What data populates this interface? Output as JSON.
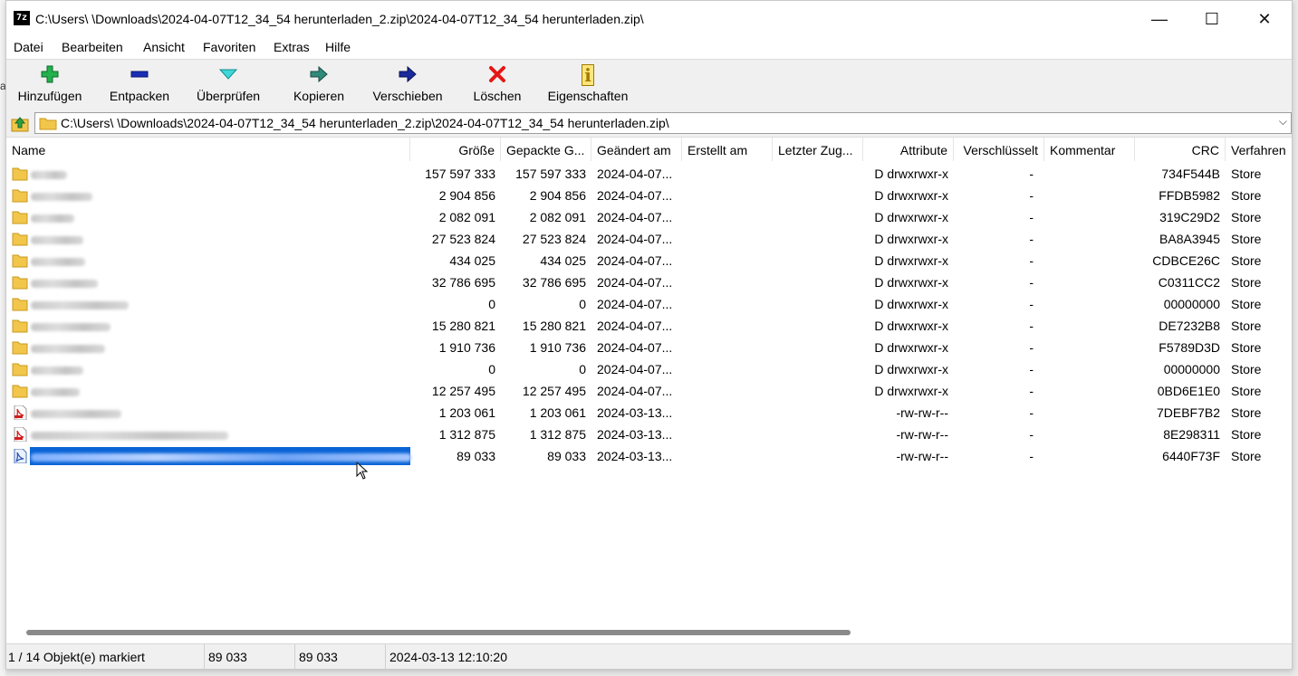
{
  "window": {
    "title": "C:\\Users\\        \\Downloads\\2024-04-07T12_34_54 herunterladen_2.zip\\2024-04-07T12_34_54 herunterladen.zip\\",
    "app_icon_text": "7z",
    "minimize": "—",
    "maximize": "☐",
    "close": "✕"
  },
  "menu": [
    "Datei",
    "Bearbeiten",
    "Ansicht",
    "Favoriten",
    "Extras",
    "Hilfe"
  ],
  "toolbar": {
    "add": "Hinzufügen",
    "extract": "Entpacken",
    "test": "Überprüfen",
    "copy": "Kopieren",
    "move": "Verschieben",
    "delete": "Löschen",
    "info": "Eigenschaften",
    "info_glyph": "i"
  },
  "address": {
    "path": "C:\\Users\\        \\Downloads\\2024-04-07T12_34_54 herunterladen_2.zip\\2024-04-07T12_34_54 herunterladen.zip\\",
    "chevron": "⌵"
  },
  "columns": {
    "name": "Name",
    "size": "Größe",
    "packed": "Gepackte G...",
    "modified": "Geändert am",
    "created": "Erstellt am",
    "accessed": "Letzter Zug...",
    "attributes": "Attribute",
    "encrypted": "Verschlüsselt",
    "comment": "Kommentar",
    "crc": "CRC",
    "method": "Verfahren"
  },
  "rows": [
    {
      "type": "folder",
      "size": "157 597 333",
      "packed": "157 597 333",
      "modified": "2024-04-07...",
      "attr": "D drwxrwxr-x",
      "enc": "-",
      "crc": "734F544B",
      "method": "Store"
    },
    {
      "type": "folder",
      "size": "2 904 856",
      "packed": "2 904 856",
      "modified": "2024-04-07...",
      "attr": "D drwxrwxr-x",
      "enc": "-",
      "crc": "FFDB5982",
      "method": "Store"
    },
    {
      "type": "folder",
      "size": "2 082 091",
      "packed": "2 082 091",
      "modified": "2024-04-07...",
      "attr": "D drwxrwxr-x",
      "enc": "-",
      "crc": "319C29D2",
      "method": "Store"
    },
    {
      "type": "folder",
      "size": "27 523 824",
      "packed": "27 523 824",
      "modified": "2024-04-07...",
      "attr": "D drwxrwxr-x",
      "enc": "-",
      "crc": "BA8A3945",
      "method": "Store"
    },
    {
      "type": "folder",
      "size": "434 025",
      "packed": "434 025",
      "modified": "2024-04-07...",
      "attr": "D drwxrwxr-x",
      "enc": "-",
      "crc": "CDBCE26C",
      "method": "Store"
    },
    {
      "type": "folder",
      "size": "32 786 695",
      "packed": "32 786 695",
      "modified": "2024-04-07...",
      "attr": "D drwxrwxr-x",
      "enc": "-",
      "crc": "C0311CC2",
      "method": "Store"
    },
    {
      "type": "folder",
      "size": "0",
      "packed": "0",
      "modified": "2024-04-07...",
      "attr": "D drwxrwxr-x",
      "enc": "-",
      "crc": "00000000",
      "method": "Store"
    },
    {
      "type": "folder",
      "size": "15 280 821",
      "packed": "15 280 821",
      "modified": "2024-04-07...",
      "attr": "D drwxrwxr-x",
      "enc": "-",
      "crc": "DE7232B8",
      "method": "Store"
    },
    {
      "type": "folder",
      "size": "1 910 736",
      "packed": "1 910 736",
      "modified": "2024-04-07...",
      "attr": "D drwxrwxr-x",
      "enc": "-",
      "crc": "F5789D3D",
      "method": "Store"
    },
    {
      "type": "folder",
      "size": "0",
      "packed": "0",
      "modified": "2024-04-07...",
      "attr": "D drwxrwxr-x",
      "enc": "-",
      "crc": "00000000",
      "method": "Store"
    },
    {
      "type": "folder",
      "size": "12 257 495",
      "packed": "12 257 495",
      "modified": "2024-04-07...",
      "attr": "D drwxrwxr-x",
      "enc": "-",
      "crc": "0BD6E1E0",
      "method": "Store"
    },
    {
      "type": "pdf",
      "size": "1 203 061",
      "packed": "1 203 061",
      "modified": "2024-03-13...",
      "attr": "-rw-rw-r--",
      "enc": "-",
      "crc": "7DEBF7B2",
      "method": "Store"
    },
    {
      "type": "pdf",
      "size": "1 312 875",
      "packed": "1 312 875",
      "modified": "2024-03-13...",
      "attr": "-rw-rw-r--",
      "enc": "-",
      "crc": "8E298311",
      "method": "Store"
    },
    {
      "type": "doc",
      "size": "89 033",
      "packed": "89 033",
      "modified": "2024-03-13...",
      "attr": "-rw-rw-r--",
      "enc": "-",
      "crc": "6440F73F",
      "method": "Store",
      "selected": true
    }
  ],
  "status": {
    "selection": "1 / 14 Objekt(e) markiert",
    "size": "89 033",
    "packed": "89 033",
    "modified": "2024-03-13 12:10:20"
  },
  "colors": {
    "selection": "#0a64d6",
    "folder": "#f2c64b",
    "add_green": "#22b14c",
    "extract_blue": "#1a2fb5",
    "delete_red": "#e51616"
  }
}
